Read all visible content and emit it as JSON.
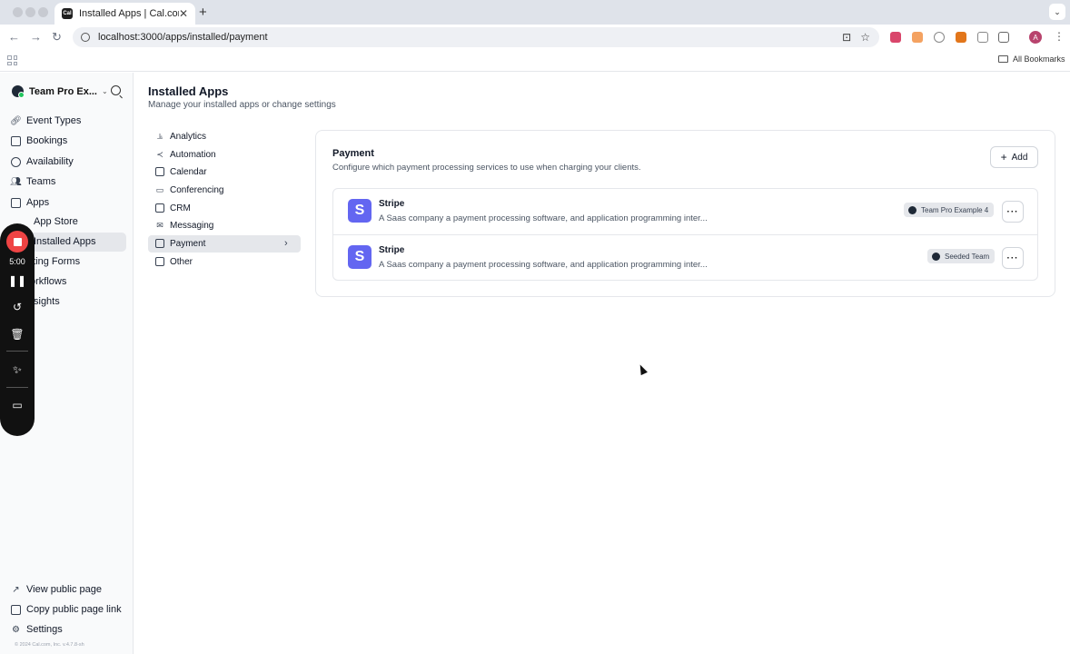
{
  "browser": {
    "tab_title": "Installed Apps | Cal.com",
    "favicon_text": "Cal",
    "url": "localhost:3000/apps/installed/payment",
    "bookmarks_label": "All Bookmarks",
    "profile_initial": "A"
  },
  "sidebar": {
    "team_name": "Team Pro Ex...",
    "items": [
      {
        "label": "Event Types",
        "icon": "link-icon"
      },
      {
        "label": "Bookings",
        "icon": "calendar-icon"
      },
      {
        "label": "Availability",
        "icon": "clock-icon"
      },
      {
        "label": "Teams",
        "icon": "users-icon"
      },
      {
        "label": "Apps",
        "icon": "grid-icon"
      }
    ],
    "sub_items": [
      {
        "label": "App Store"
      },
      {
        "label": "Installed Apps"
      }
    ],
    "more_items": [
      {
        "label": "uting Forms"
      },
      {
        "label": "orkflows"
      },
      {
        "label": "sights"
      }
    ],
    "footer_items": [
      {
        "label": "View public page",
        "icon": "external-link-icon"
      },
      {
        "label": "Copy public page link",
        "icon": "copy-icon"
      },
      {
        "label": "Settings",
        "icon": "gear-icon"
      }
    ],
    "copyright": "© 2024 Cal.com, Inc. v.4.7.8-sh"
  },
  "recorder": {
    "time": "5:00"
  },
  "main": {
    "title": "Installed Apps",
    "subtitle": "Manage your installed apps or change settings",
    "categories": [
      {
        "label": "Analytics",
        "icon": "chart-icon"
      },
      {
        "label": "Automation",
        "icon": "share-icon"
      },
      {
        "label": "Calendar",
        "icon": "calendar-icon"
      },
      {
        "label": "Conferencing",
        "icon": "video-icon"
      },
      {
        "label": "CRM",
        "icon": "contact-icon"
      },
      {
        "label": "Messaging",
        "icon": "mail-icon"
      },
      {
        "label": "Payment",
        "icon": "credit-card-icon",
        "active": true
      },
      {
        "label": "Other",
        "icon": "grid-icon"
      }
    ],
    "panel": {
      "title": "Payment",
      "subtitle": "Configure which payment processing services to use when charging your clients.",
      "add_label": "Add",
      "apps": [
        {
          "logo_letter": "S",
          "name": "Stripe",
          "description": "A Saas company a payment processing software, and application programming inter...",
          "team": "Team Pro Example 4"
        },
        {
          "logo_letter": "S",
          "name": "Stripe",
          "description": "A Saas company a payment processing software, and application programming inter...",
          "team": "Seeded Team"
        }
      ]
    }
  },
  "colors": {
    "stripe": "#6366f1",
    "recorder_stop": "#ef4444",
    "active_bg": "#e5e7eb"
  }
}
